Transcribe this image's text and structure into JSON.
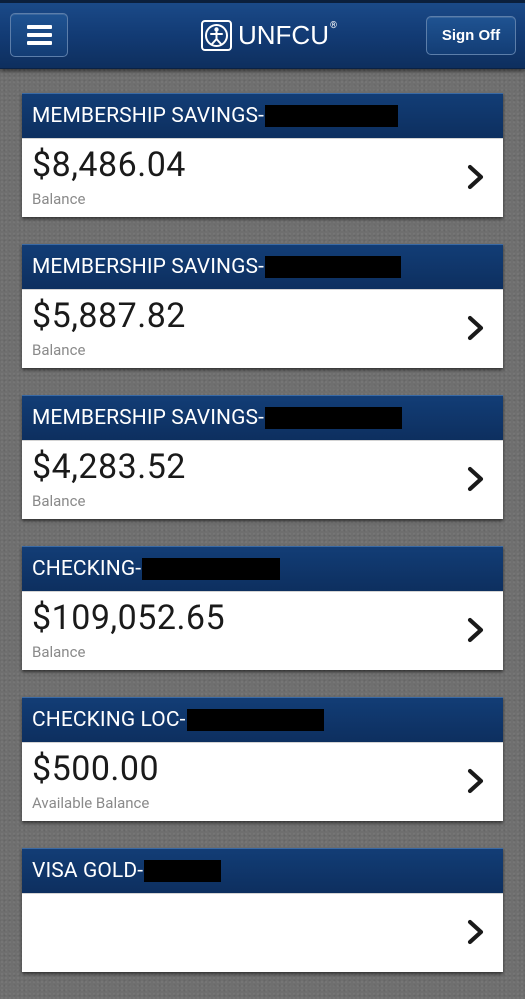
{
  "header": {
    "menu_icon": "hamburger-menu-icon",
    "logo_text": "UNFCU",
    "logo_reg": "®",
    "sign_off_label": "Sign Off",
    "colors": {
      "header_bg": "#143f78",
      "card_header_bg": "#0f3566",
      "page_bg": "#6f6f6f"
    }
  },
  "accounts": [
    {
      "name": "MEMBERSHIP SAVINGS-",
      "amount": "$8,486.04",
      "label": "Balance"
    },
    {
      "name": "MEMBERSHIP SAVINGS-",
      "amount": "$5,887.82",
      "label": "Balance"
    },
    {
      "name": "MEMBERSHIP SAVINGS-",
      "amount": "$4,283.52",
      "label": "Balance"
    },
    {
      "name": "CHECKING-",
      "amount": "$109,052.65",
      "label": "Balance"
    },
    {
      "name": "CHECKING LOC-",
      "amount": "$500.00",
      "label": "Available Balance"
    },
    {
      "name": "VISA GOLD-",
      "amount": "",
      "label": ""
    }
  ]
}
